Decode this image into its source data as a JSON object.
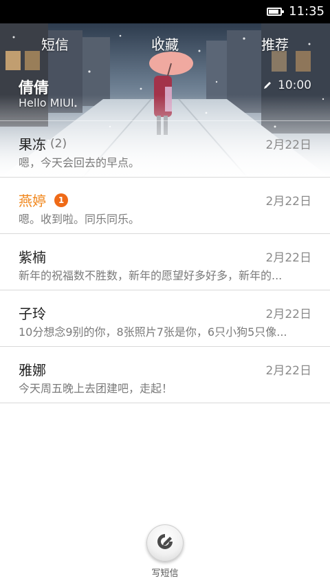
{
  "status_bar": {
    "time": "11:35",
    "battery_level": 0.9,
    "battery_icon": "battery-icon"
  },
  "tabs": [
    {
      "label": "短信"
    },
    {
      "label": "收藏"
    },
    {
      "label": "推荐"
    }
  ],
  "featured": {
    "name": "倩倩",
    "preview": "Hello MIUI",
    "time": "10:00",
    "icon": "pencil-icon"
  },
  "conversations": [
    {
      "name": "果冻",
      "count": "(2)",
      "date": "2月22日",
      "snippet": "嗯，今天会回去的早点。"
    },
    {
      "name": "燕婷",
      "badge": "1",
      "date": "2月22日",
      "snippet": "嗯。收到啦。同乐同乐。",
      "unread": true
    },
    {
      "name": "紫楠",
      "date": "2月22日",
      "snippet": "新年的祝福数不胜数，新年的愿望好多好多，新年的..."
    },
    {
      "name": "子玲",
      "date": "2月22日",
      "snippet": "10分想念9别的你，8张照片7张是你，6只小狗5只像..."
    },
    {
      "name": "雅娜",
      "date": "2月22日",
      "snippet": "今天周五晚上去团建吧，走起！"
    }
  ],
  "compose": {
    "label": "写短信",
    "icon": "compose-icon"
  },
  "colors": {
    "unread_name": "#f08519",
    "badge": "#ef6a17",
    "status_bar": "#000000"
  }
}
